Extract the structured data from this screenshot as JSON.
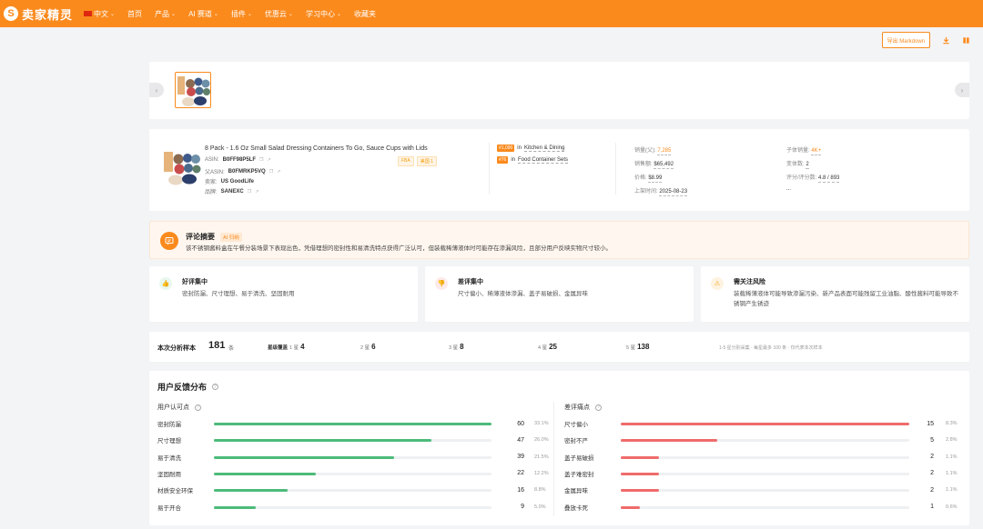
{
  "header": {
    "logo_glyph": "S",
    "logo_text": "卖家精灵",
    "nav": [
      {
        "label": "中文",
        "dropdown": true,
        "flag": true
      },
      {
        "label": "首页",
        "dropdown": false
      },
      {
        "label": "产品",
        "dropdown": true
      },
      {
        "label": "AI 赛道",
        "dropdown": true
      },
      {
        "label": "插件",
        "dropdown": true
      },
      {
        "label": "优惠云",
        "dropdown": true
      },
      {
        "label": "学习中心",
        "dropdown": true
      },
      {
        "label": "收藏夹",
        "dropdown": false
      }
    ]
  },
  "toolbar": {
    "export_label": "导出 Markdown"
  },
  "product": {
    "title": "8 Pack - 1.6 Oz Small Salad Dressing Containers To Go, Sauce Cups with Lids",
    "asin_label": "ASIN:",
    "asin": "B0FF98P5LF",
    "parent_asin_label": "父ASIN:",
    "parent_asin": "B0FMRKP5VQ",
    "seller_label": "卖家:",
    "seller": "US GoodLife",
    "brand_label": "品牌:",
    "brand": "SANEXC",
    "tags": [
      "FBA",
      "美国 1"
    ],
    "ranks": [
      {
        "badge": "#1,090",
        "prep": "in",
        "category": "Kitchen & Dining"
      },
      {
        "badge": "#76",
        "prep": "in",
        "category": "Food Container Sets"
      }
    ],
    "stats_left": [
      {
        "label": "销量(父):",
        "value": "7,285",
        "orange": true
      },
      {
        "label": "销售额:",
        "value": "$65,492",
        "orange": false
      },
      {
        "label": "价格:",
        "value": "$8.99",
        "orange": false
      },
      {
        "label": "上架时间:",
        "value": "2025-08-23",
        "orange": false
      }
    ],
    "stats_right": [
      {
        "label": "子体销量:",
        "value": "4K+",
        "orange": true
      },
      {
        "label": "变体数:",
        "value": "2",
        "orange": false
      },
      {
        "label": "评分/评分数:",
        "value": "4.8 / 893",
        "orange": false
      },
      {
        "label": "",
        "value": "...",
        "orange": false
      }
    ]
  },
  "summary": {
    "title": "评论摘要",
    "badge": "AI 归纳",
    "text": "该不锈钢酱料盒在午餐分装场景下表现出色，凭借理想的密封性和易清洗特点获得广泛认可，但装载稀薄液体时可能存在渗漏风险，且部分用户反映实物尺寸较小。"
  },
  "insights": [
    {
      "title": "好评集中",
      "text": "密封防漏、尺寸理想、易于清洗、坚固耐用",
      "color": "#22c55e",
      "bg": "#e8f8ee",
      "icon": "thumbs-up-icon",
      "glyph": "👍"
    },
    {
      "title": "差评集中",
      "text": "尺寸偏小、稀薄液体渗漏、盖子易破损、金属异味",
      "color": "#ef4444",
      "bg": "#fdeaea",
      "icon": "thumbs-down-icon",
      "glyph": "👎"
    },
    {
      "title": "需关注风险",
      "text": "装载稀薄液体可能导致渗漏污染、新产品表面可能残留工业油脂、酸性酱料可能导致不锈钢产生锈迹",
      "color": "#f59e0b",
      "bg": "#fef3e0",
      "icon": "warning-icon",
      "glyph": "⚠"
    }
  ],
  "sample": {
    "label": "本次分析样本",
    "count": "181",
    "unit": "条",
    "coverage_label": "星级覆盖",
    "stars": [
      {
        "label": "1 星",
        "value": "4"
      },
      {
        "label": "2 星",
        "value": "6"
      },
      {
        "label": "3 星",
        "value": "8"
      },
      {
        "label": "4 星",
        "value": "25"
      },
      {
        "label": "5 星",
        "value": "138"
      }
    ],
    "note": "1-5 星分别采集 · 每星最多 100 条 · 仅代表本次样本"
  },
  "distribution": {
    "title": "用户反馈分布",
    "positive": {
      "title": "用户认可点",
      "color": "#4cbb7a",
      "max": 60,
      "items": [
        {
          "label": "密封防漏",
          "count": "60",
          "value": 60,
          "pct": "33.1%"
        },
        {
          "label": "尺寸理想",
          "count": "47",
          "value": 47,
          "pct": "26.0%"
        },
        {
          "label": "易于清洗",
          "count": "39",
          "value": 39,
          "pct": "21.5%"
        },
        {
          "label": "坚固耐用",
          "count": "22",
          "value": 22,
          "pct": "12.2%"
        },
        {
          "label": "材质安全环保",
          "count": "16",
          "value": 16,
          "pct": "8.8%"
        },
        {
          "label": "易于开合",
          "count": "9",
          "value": 9,
          "pct": "5.0%"
        }
      ]
    },
    "negative": {
      "title": "差评痛点",
      "color": "#ef6b6b",
      "max": 15,
      "items": [
        {
          "label": "尺寸偏小",
          "count": "15",
          "value": 15,
          "pct": "8.3%"
        },
        {
          "label": "密封不严",
          "count": "5",
          "value": 5,
          "pct": "2.8%"
        },
        {
          "label": "盖子易破损",
          "count": "2",
          "value": 2,
          "pct": "1.1%"
        },
        {
          "label": "盖子难密封",
          "count": "2",
          "value": 2,
          "pct": "1.1%"
        },
        {
          "label": "金属异味",
          "count": "2",
          "value": 2,
          "pct": "1.1%"
        },
        {
          "label": "叠放卡死",
          "count": "1",
          "value": 1,
          "pct": "0.6%"
        }
      ]
    }
  }
}
